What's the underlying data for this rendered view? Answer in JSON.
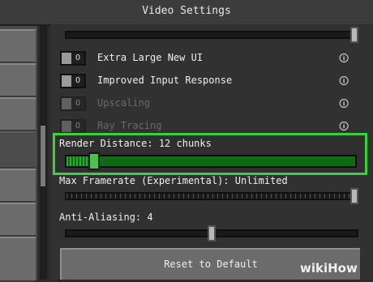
{
  "window": {
    "title": "Video Settings"
  },
  "options": [
    {
      "label": "Extra Large New UI",
      "disabled": false,
      "info_icon": "lightbulb-icon"
    },
    {
      "label": "Improved Input Response",
      "disabled": false,
      "info_icon": "lightbulb-icon"
    },
    {
      "label": "Upscaling",
      "disabled": true,
      "info_icon": "lightbulb-icon"
    },
    {
      "label": "Ray Tracing",
      "disabled": true,
      "info_icon": "lightbulb-icon"
    }
  ],
  "toggle_text": "O",
  "render_distance": {
    "label": "Render Distance: 12 chunks",
    "value_fraction": 0.1
  },
  "max_framerate": {
    "label": "Max Framerate (Experimental): Unlimited",
    "value_fraction": 1.0
  },
  "anti_aliasing": {
    "label": "Anti-Aliasing: 4",
    "value_fraction": 0.5
  },
  "top_slider": {
    "value_fraction": 1.0
  },
  "buttons": {
    "reset": "Reset to Default"
  },
  "watermark": "wikiHow",
  "colors": {
    "highlight": "#37d437",
    "render_track": "#0e6b11",
    "render_thumb": "#49c449"
  }
}
